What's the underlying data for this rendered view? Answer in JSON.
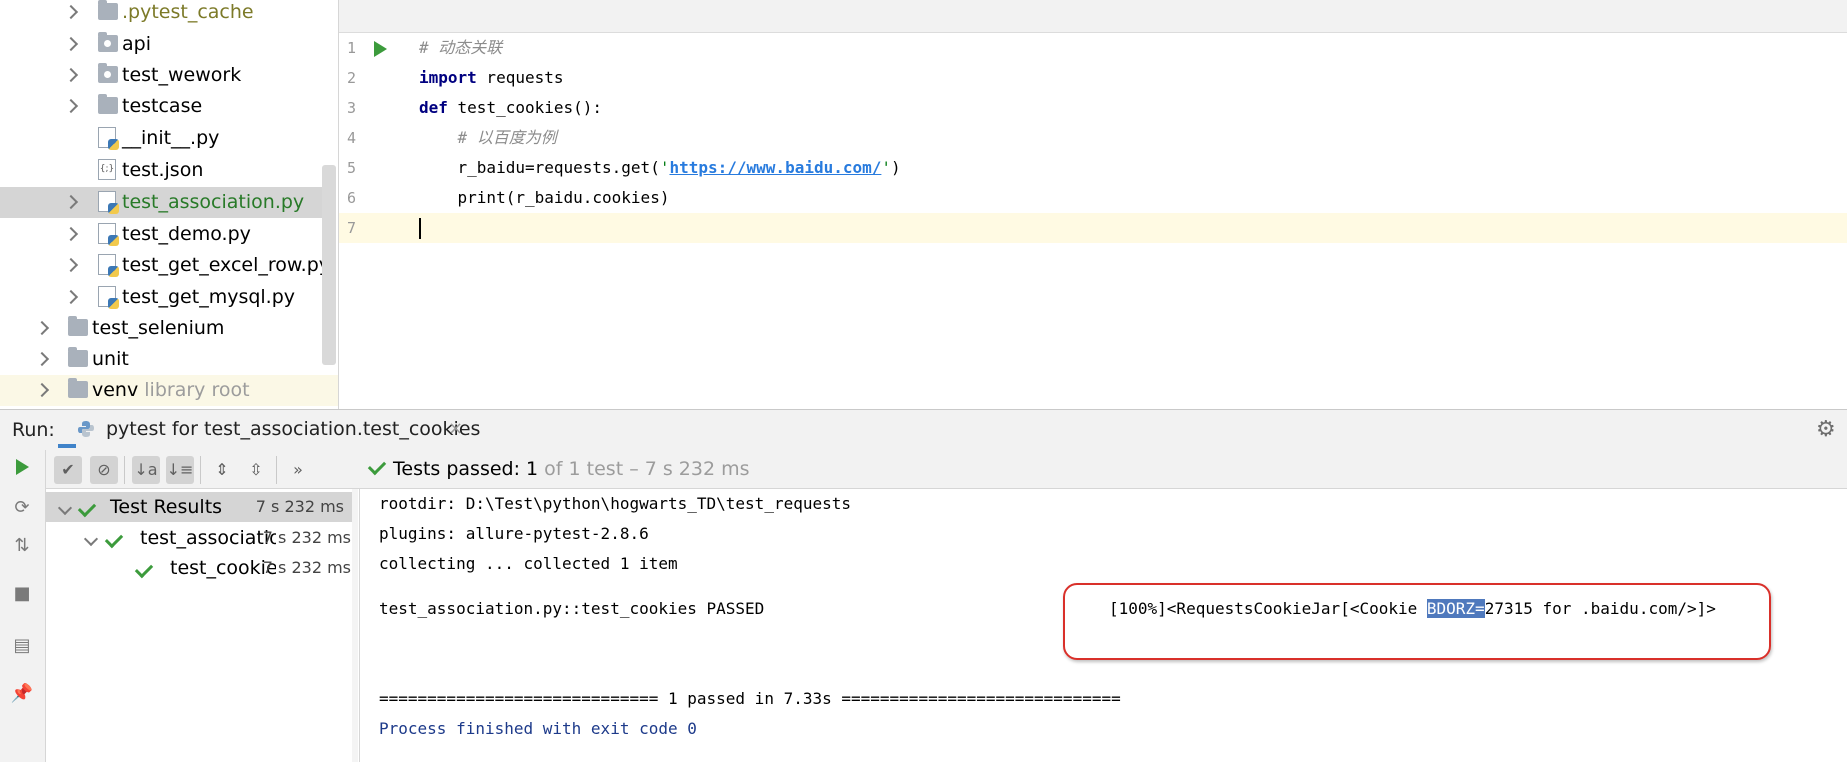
{
  "project_tree": {
    "items": [
      {
        "label": ".pytest_cache"
      },
      {
        "label": "api"
      },
      {
        "label": "test_wework"
      },
      {
        "label": "testcase"
      },
      {
        "label": "__init__.py"
      },
      {
        "label": "test.json"
      },
      {
        "label": "test_association.py"
      },
      {
        "label": "test_demo.py"
      },
      {
        "label": "test_get_excel_row.py"
      },
      {
        "label": "test_get_mysql.py"
      },
      {
        "label": "test_selenium"
      },
      {
        "label": "unit"
      },
      {
        "label": "venv",
        "suffix": "library root"
      }
    ]
  },
  "editor": {
    "lines": [
      {
        "num": "1",
        "parts": [
          {
            "cls": "cmt",
            "t": "# 动态关联"
          }
        ]
      },
      {
        "num": "2",
        "parts": [
          {
            "cls": "kw",
            "t": "import"
          },
          {
            "cls": "fn",
            "t": " requests"
          }
        ]
      },
      {
        "num": "3",
        "parts": [
          {
            "cls": "kw",
            "t": "def"
          },
          {
            "cls": "fn",
            "t": " test_cookies():"
          }
        ]
      },
      {
        "num": "4",
        "parts": [
          {
            "cls": "cmt",
            "t": "    # 以百度为例"
          }
        ]
      },
      {
        "num": "5",
        "parts": [
          {
            "cls": "fn",
            "t": "    r_baidu=requests.get("
          },
          {
            "cls": "str",
            "t": "'"
          },
          {
            "cls": "url",
            "t": "https://www.baidu.com/"
          },
          {
            "cls": "str",
            "t": "'"
          },
          {
            "cls": "fn",
            "t": ")"
          }
        ]
      },
      {
        "num": "6",
        "parts": [
          {
            "cls": "fn",
            "t": "    print(r_baidu.cookies)"
          }
        ]
      },
      {
        "num": "7",
        "parts": []
      }
    ]
  },
  "run_panel": {
    "label": "Run:",
    "tab_title": "pytest for test_association.test_cookies",
    "close_glyph": "×",
    "status": {
      "passed_text": "Tests passed: 1",
      "detail_text": " of 1 test – 7 s 232 ms"
    },
    "results": [
      {
        "label": "Test Results",
        "time": "7 s 232 ms"
      },
      {
        "label": "test_association",
        "time": "7 s 232 ms"
      },
      {
        "label": "test_cookies",
        "time": "7 s 232 ms"
      }
    ],
    "console": {
      "line1": "rootdir: D:\\Test\\python\\hogwarts_TD\\test_requests",
      "line2": "plugins: allure-pytest-2.8.6",
      "line3": "collecting ... collected 1 item",
      "line4": "test_association.py::test_cookies PASSED",
      "result_pre": "[100%]<RequestsCookieJar[<Cookie ",
      "result_hl": "BDORZ=",
      "result_post": "27315 for .baidu.com/>]>",
      "summary": "============================= 1 passed in 7.33s =============================",
      "exit": "Process finished with exit code 0"
    }
  },
  "colors": {
    "accent": "#4083c9",
    "pass_green": "#3c9b3c",
    "annotation_red": "#d9302a"
  }
}
